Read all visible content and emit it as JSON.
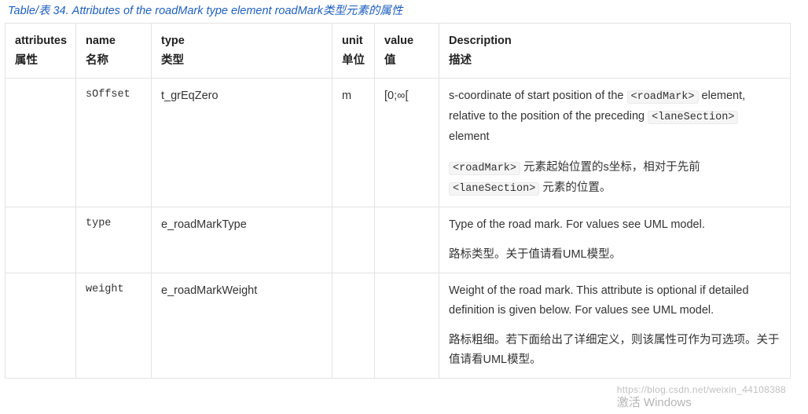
{
  "caption": "Table/表 34. Attributes of the roadMark type element roadMark类型元素的属性",
  "headers": {
    "attributes": {
      "en": "attributes",
      "zh": "属性"
    },
    "name": {
      "en": "name",
      "zh": "名称"
    },
    "type": {
      "en": "type",
      "zh": "类型"
    },
    "unit": {
      "en": "unit",
      "zh": "单位"
    },
    "value": {
      "en": "value",
      "zh": "值"
    },
    "description": {
      "en": "Description",
      "zh": "描述"
    }
  },
  "rows": [
    {
      "attributes": "",
      "name": "sOffset",
      "type": "t_grEqZero",
      "unit": "m",
      "value": "[0;∞[",
      "desc_en_pre": "s-coordinate of start position of the ",
      "desc_en_code1": "<roadMark>",
      "desc_en_mid": " element, relative to the position of the preceding ",
      "desc_en_code2": "<laneSection>",
      "desc_en_post": " element",
      "desc_zh_code1": "<roadMark>",
      "desc_zh_mid": " 元素起始位置的s坐标，相对于先前 ",
      "desc_zh_code2": "<laneSection>",
      "desc_zh_post": " 元素的位置。"
    },
    {
      "attributes": "",
      "name": "type",
      "type": "e_roadMarkType",
      "unit": "",
      "value": "",
      "desc_en": "Type of the road mark. For values see UML model.",
      "desc_zh": "路标类型。关于值请看UML模型。"
    },
    {
      "attributes": "",
      "name": "weight",
      "type": "e_roadMarkWeight",
      "unit": "",
      "value": "",
      "desc_en": "Weight of the road mark. This attribute is optional if detailed definition is given below. For values see UML model.",
      "desc_zh": "路标粗细。若下面给出了详细定义，则该属性可作为可选项。关于值请看UML模型。"
    }
  ],
  "watermark": {
    "url": "https://blog.csdn.net/weixin_44108388",
    "line1": "激活 Windows"
  }
}
